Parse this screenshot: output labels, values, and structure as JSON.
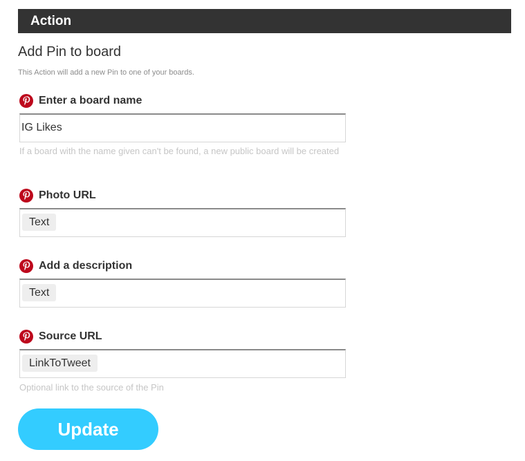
{
  "header": {
    "title": "Action"
  },
  "action": {
    "title": "Add Pin to board",
    "description": "This Action will add a new Pin to one of your boards."
  },
  "fields": [
    {
      "label": "Enter a board name",
      "value": "IG Likes",
      "help": "If a board with the name given can't be found, a new public board will be created"
    },
    {
      "label": "Photo URL",
      "ingredient": "Text"
    },
    {
      "label": "Add a description",
      "ingredient": "Text"
    },
    {
      "label": "Source URL",
      "ingredient": "LinkToTweet",
      "help": "Optional link to the source of the Pin"
    }
  ],
  "buttons": {
    "update_label": "Update"
  },
  "colors": {
    "header_bg": "#333333",
    "pinterest_red": "#bd081c",
    "button_bg": "#33ccff",
    "help_text": "#c6c6c6"
  },
  "icons": {
    "field_icon": "pinterest-logo-icon"
  }
}
